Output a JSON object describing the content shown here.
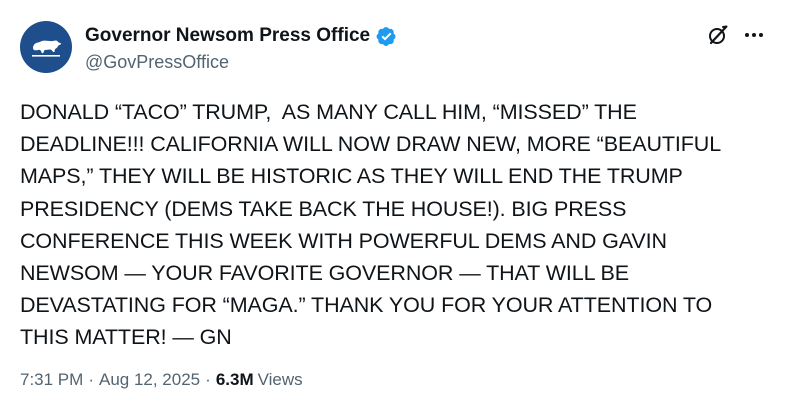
{
  "account": {
    "display_name": "Governor Newsom Press Office",
    "handle": "@GovPressOffice",
    "avatar_icon": "california-bear-icon",
    "avatar_color": "#1f4e8c",
    "verified_color": "#1d9bf0"
  },
  "header_actions": {
    "grok_icon": "grok-icon",
    "more_icon": "more-icon"
  },
  "tweet": {
    "text": "DONALD “TACO” TRUMP,  AS MANY CALL HIM, “MISSED” THE\nDEADLINE!!! CALIFORNIA WILL NOW DRAW NEW, MORE “BEAUTIFUL\nMAPS,” THEY WILL BE HISTORIC AS THEY WILL END THE TRUMP\nPRESIDENCY (DEMS TAKE BACK THE HOUSE!). BIG PRESS\nCONFERENCE THIS WEEK WITH POWERFUL DEMS AND GAVIN\nNEWSOM — YOUR FAVORITE GOVERNOR — THAT WILL BE\nDEVASTATING FOR “MAGA.” THANK YOU FOR YOUR ATTENTION TO\nTHIS MATTER! — GN",
    "time": "7:31 PM",
    "separator": "·",
    "date": "Aug 12, 2025",
    "views_count": "6.3M",
    "views_label": "Views"
  }
}
